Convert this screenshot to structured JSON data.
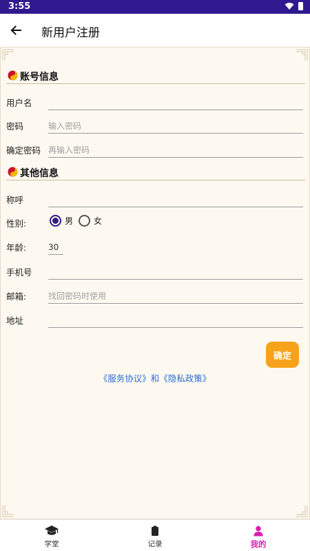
{
  "status_bar": {
    "time": "3:55"
  },
  "header": {
    "title": "新用户注册"
  },
  "sections": {
    "account": {
      "title": "账号信息"
    },
    "other": {
      "title": "其他信息"
    }
  },
  "fields": {
    "username": {
      "label": "用户名",
      "value": "",
      "placeholder": ""
    },
    "password": {
      "label": "密码",
      "value": "",
      "placeholder": "输入密码"
    },
    "confirm_password": {
      "label": "确定密码",
      "value": "",
      "placeholder": "再输入密码"
    },
    "nickname": {
      "label": "称呼",
      "value": "",
      "placeholder": ""
    },
    "gender": {
      "label": "性别:",
      "options": [
        "男",
        "女"
      ],
      "selected": "男"
    },
    "age": {
      "label": "年龄:",
      "value": "30"
    },
    "phone": {
      "label": "手机号",
      "value": "",
      "placeholder": ""
    },
    "email": {
      "label": "邮箱:",
      "value": "",
      "placeholder": "找回密码时使用"
    },
    "address": {
      "label": "地址",
      "value": "",
      "placeholder": ""
    }
  },
  "actions": {
    "confirm_label": "确定"
  },
  "agreement": {
    "text": "《服务协议》和《隐私政策》"
  },
  "bottom_nav": {
    "items": [
      {
        "label": "学堂",
        "icon": "graduation-cap-icon"
      },
      {
        "label": "记录",
        "icon": "clipboard-icon"
      },
      {
        "label": "我的",
        "icon": "person-icon",
        "active": true
      }
    ]
  },
  "colors": {
    "status_bar": "#2e1a8e",
    "accent": "#f7a21b",
    "link": "#2e6fd1",
    "nav_active": "#d91fb4",
    "panel_bg": "#fdf9f1"
  }
}
